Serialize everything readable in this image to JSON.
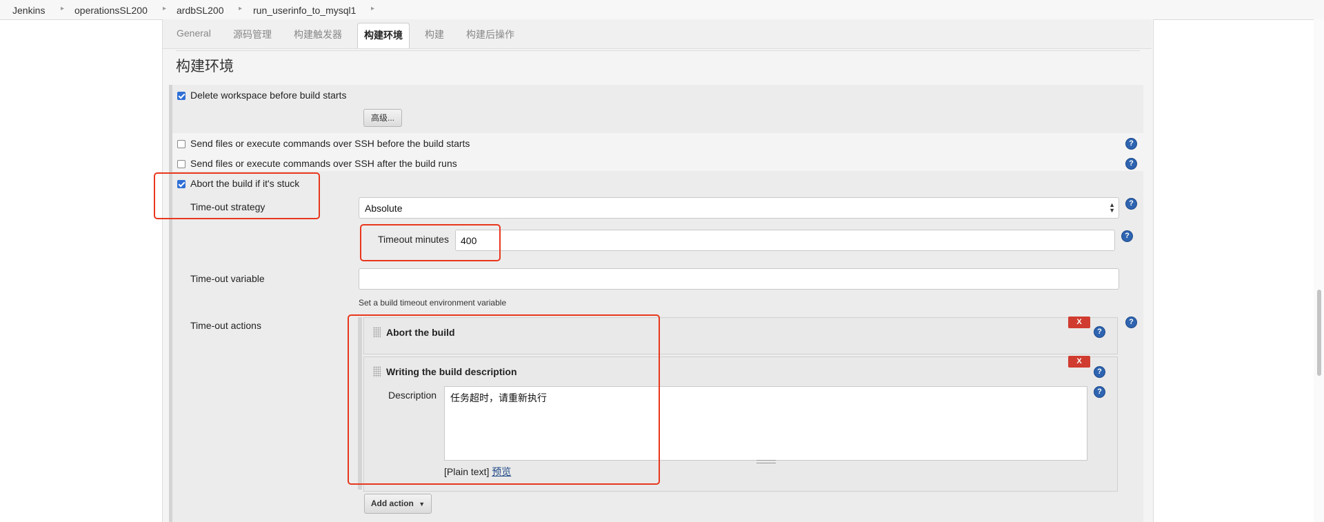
{
  "breadcrumb": {
    "items": [
      "Jenkins",
      "operationsSL200",
      "ardbSL200",
      "run_userinfo_to_mysql1"
    ]
  },
  "tabs": {
    "items": [
      "General",
      "源码管理",
      "构建触发器",
      "构建环境",
      "构建",
      "构建后操作"
    ],
    "active": "构建环境"
  },
  "section": {
    "title": "构建环境"
  },
  "options": {
    "delete_workspace": {
      "label": "Delete workspace before build starts",
      "checked": true
    },
    "advanced_button": "高级...",
    "ssh_before": {
      "label": "Send files or execute commands over SSH before the build starts",
      "checked": false
    },
    "ssh_after": {
      "label": "Send files or execute commands over SSH after the build runs",
      "checked": false
    },
    "abort_stuck": {
      "label": "Abort the build if it's stuck",
      "checked": true
    }
  },
  "timeout": {
    "strategy_label": "Time-out strategy",
    "strategy_value": "Absolute",
    "minutes_label": "Timeout minutes",
    "minutes_value": "400",
    "variable_label": "Time-out variable",
    "variable_value": "",
    "variable_hint": "Set a build timeout environment variable",
    "actions_label": "Time-out actions"
  },
  "actions": {
    "abort": {
      "title": "Abort the build",
      "delete_label": "X"
    },
    "description": {
      "title": "Writing the build description",
      "delete_label": "X",
      "field_label": "Description",
      "value": "任务超时，请重新执行",
      "format_text": "[Plain text]",
      "preview_link": "预览"
    },
    "add_button": "Add action"
  },
  "help_glyph": "?",
  "colors": {
    "highlight_red": "#e8361c",
    "delete_red": "#d03c2f",
    "help_blue": "#2e64b0",
    "link_blue": "#204a87"
  }
}
